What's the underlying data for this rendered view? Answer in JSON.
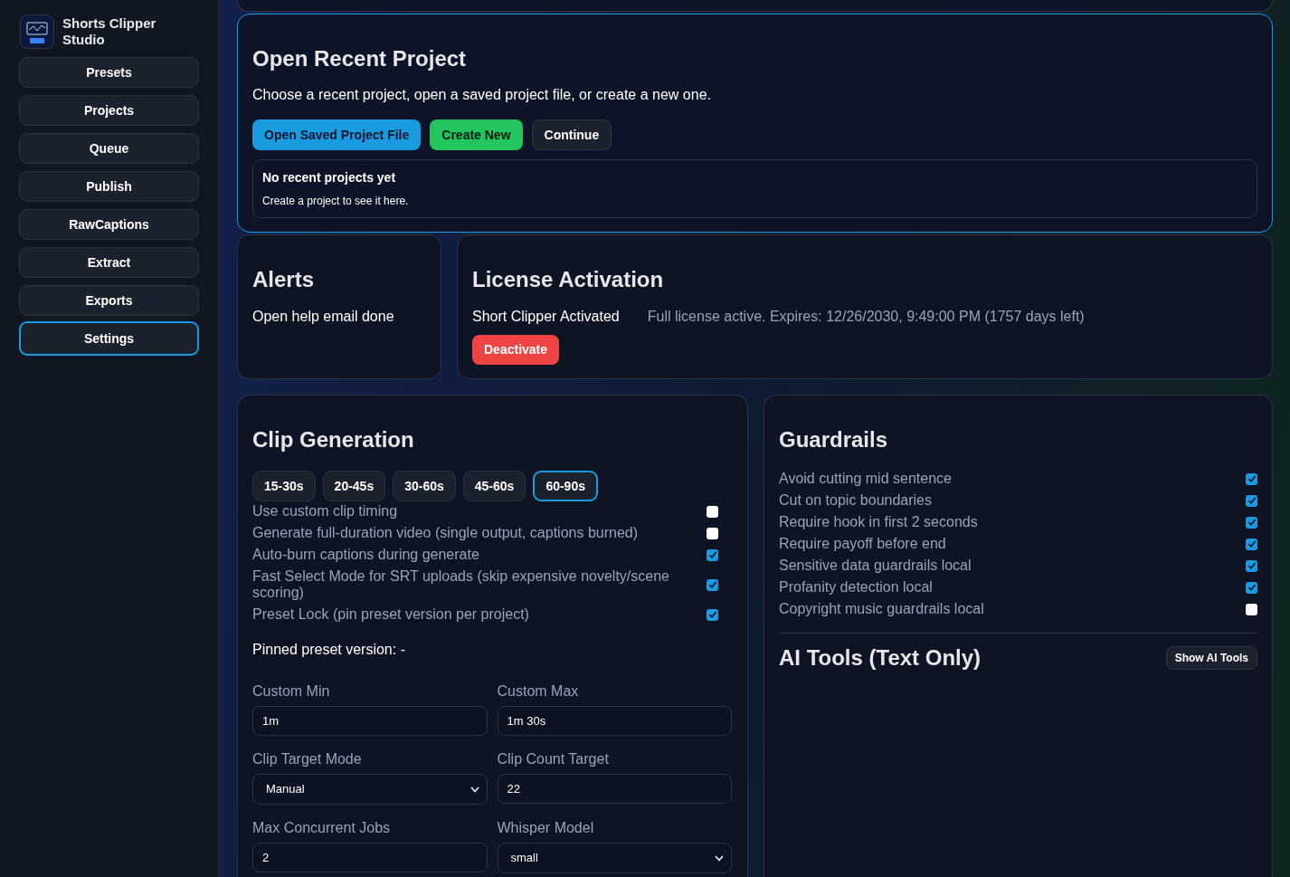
{
  "app": {
    "name": "Shorts Clipper Studio"
  },
  "nav": [
    {
      "label": "Presets",
      "selected": false
    },
    {
      "label": "Projects",
      "selected": false
    },
    {
      "label": "Queue",
      "selected": false
    },
    {
      "label": "Publish",
      "selected": false
    },
    {
      "label": "RawCaptions",
      "selected": false
    },
    {
      "label": "Extract",
      "selected": false
    },
    {
      "label": "Exports",
      "selected": false
    },
    {
      "label": "Settings",
      "selected": true
    }
  ],
  "recent": {
    "title": "Open Recent Project",
    "description": "Choose a recent project, open a saved project file, or create a new one.",
    "buttons": [
      {
        "label": "Open Saved Project File",
        "kind": "primary"
      },
      {
        "label": "Create New",
        "kind": "success"
      },
      {
        "label": "Continue",
        "kind": "neutral"
      }
    ],
    "empty_title": "No recent projects yet",
    "empty_text": "Create a project to see it here."
  },
  "alerts": {
    "title": "Alerts",
    "message": "Open help email done"
  },
  "license": {
    "title": "License Activation",
    "status": "Short Clipper Activated",
    "detail": "Full license active. Expires: 12/26/2030, 9:49:00 PM (1757 days left)",
    "button": "Deactivate"
  },
  "clip_generation": {
    "title": "Clip Generation",
    "ranges": [
      {
        "label": "15-30s",
        "selected": false
      },
      {
        "label": "20-45s",
        "selected": false
      },
      {
        "label": "30-60s",
        "selected": false
      },
      {
        "label": "45-60s",
        "selected": false
      },
      {
        "label": "60-90s",
        "selected": true
      }
    ],
    "options": [
      {
        "label": "Use custom clip timing",
        "checked": false
      },
      {
        "label": "Generate full-duration video (single output, captions burned)",
        "checked": false
      },
      {
        "label": "Auto-burn captions during generate",
        "checked": true
      },
      {
        "label": "Fast Select Mode for SRT uploads (skip expensive novelty/scene scoring)",
        "checked": true
      },
      {
        "label": "Preset Lock (pin preset version per project)",
        "checked": true
      }
    ],
    "pinned": "Pinned preset version: -",
    "fields": [
      {
        "label": "Custom Min",
        "value": "1m",
        "kind": "input"
      },
      {
        "label": "Custom Max",
        "value": "1m 30s",
        "kind": "input"
      },
      {
        "label": "Clip Target Mode",
        "value": "Manual",
        "kind": "select"
      },
      {
        "label": "Clip Count Target",
        "value": "22",
        "kind": "input"
      },
      {
        "label": "Max Concurrent Jobs",
        "value": "2",
        "kind": "input"
      },
      {
        "label": "Whisper Model",
        "value": "small",
        "kind": "select"
      }
    ]
  },
  "guardrails": {
    "title": "Guardrails",
    "options": [
      {
        "label": "Avoid cutting mid sentence",
        "checked": true
      },
      {
        "label": "Cut on topic boundaries",
        "checked": true
      },
      {
        "label": "Require hook in first 2 seconds",
        "checked": true
      },
      {
        "label": "Require payoff before end",
        "checked": true
      },
      {
        "label": "Sensitive data guardrails local",
        "checked": true
      },
      {
        "label": "Profanity detection local",
        "checked": true
      },
      {
        "label": "Copyright music guardrails local",
        "checked": false
      }
    ]
  },
  "ai_tools": {
    "title": "AI Tools (Text Only)",
    "button": "Show AI Tools"
  }
}
